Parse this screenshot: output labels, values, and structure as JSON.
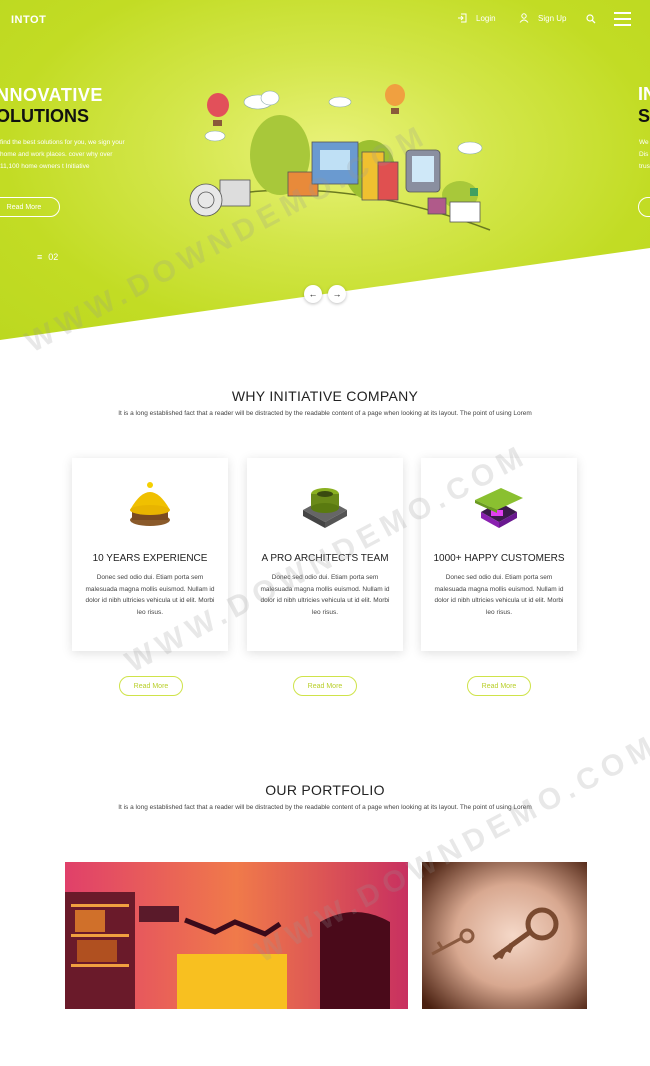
{
  "header": {
    "logo": "INTOT",
    "login_label": "Login",
    "signup_label": "Sign Up"
  },
  "hero": {
    "title_line1": "NNOVATIVE",
    "title_line2": "OLUTIONS",
    "text": "find the best solutions for you, we sign your home and work places. cover why over 11,100 home owners t Initiative",
    "read_more": "Read More",
    "slide_current": "",
    "slide_number": "02",
    "next_title_line1": "IN",
    "next_title_line2": "S",
    "next_text": "We Dis trus",
    "prev_arrow": "←",
    "next_arrow": "→"
  },
  "why": {
    "title": "WHY INITIATIVE COMPANY",
    "subtitle": "It is a long established fact that a reader will be distracted by the readable content of a page when looking at its layout. The point of using Lorem",
    "cards": [
      {
        "title": "10 YEARS EXPERIENCE",
        "text": "Donec sed odio dui. Etiam porta sem malesuada magna mollis euismod. Nullam id dolor id nibh ultricies vehicula ut id elit. Morbi leo risus.",
        "button": "Read More"
      },
      {
        "title": "A PRO ARCHITECTS TEAM",
        "text": "Donec sed odio dui. Etiam porta sem malesuada magna mollis euismod. Nullam id dolor id nibh ultricies vehicula ut id elit. Morbi leo risus.",
        "button": "Read More"
      },
      {
        "title": "1000+ HAPPY CUSTOMERS",
        "text": "Donec sed odio dui. Etiam porta sem malesuada magna mollis euismod. Nullam id dolor id nibh ultricies vehicula ut id elit. Morbi leo risus.",
        "button": "Read More"
      }
    ]
  },
  "portfolio": {
    "title": "OUR PORTFOLIO",
    "subtitle": "It is a long established fact that a reader will be distracted by the readable content of a page when looking at its layout. The point of using Lorem"
  },
  "watermark": "WWW.DOWNDEMO.COM",
  "colors": {
    "accent": "#c2dc24",
    "button_border": "#cfe34a"
  }
}
